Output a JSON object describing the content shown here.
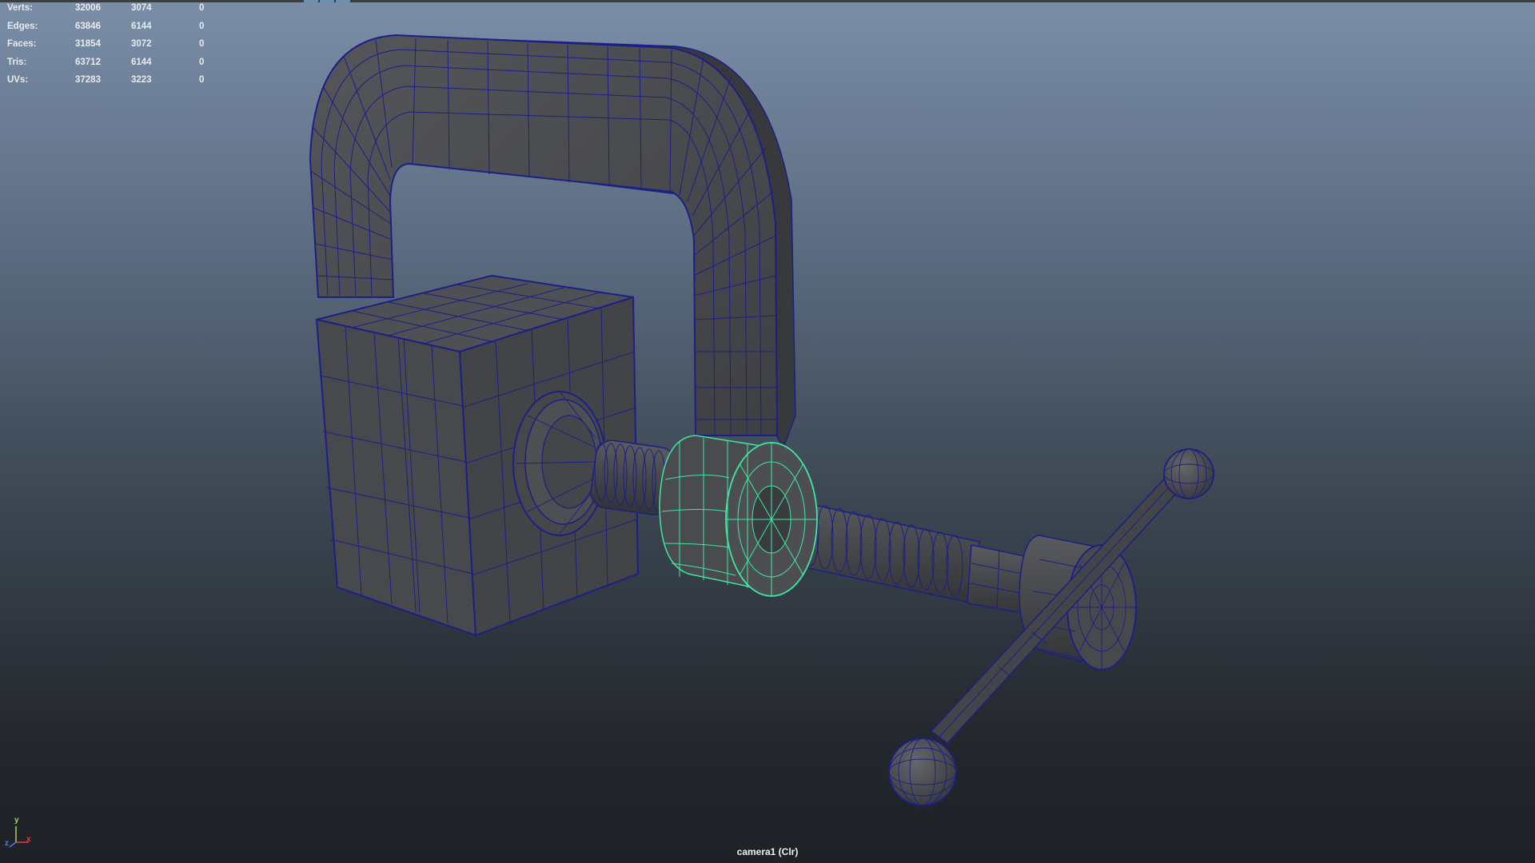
{
  "viewport": {
    "camera_label": "camera1 (Clr)"
  },
  "heads_up_display": {
    "rows": [
      {
        "label": "Verts:",
        "values": [
          "32006",
          "3074",
          "0"
        ]
      },
      {
        "label": "Edges:",
        "values": [
          "63846",
          "6144",
          "0"
        ]
      },
      {
        "label": "Faces:",
        "values": [
          "31854",
          "3072",
          "0"
        ]
      },
      {
        "label": "Tris:",
        "values": [
          "63712",
          "6144",
          "0"
        ]
      },
      {
        "label": "UVs:",
        "values": [
          "37283",
          "3223",
          "0"
        ]
      }
    ]
  },
  "axis_gizmo": {
    "y": "y",
    "x": "x",
    "z": "z"
  },
  "colors": {
    "wireframe": "#1c1f86",
    "selection_wireframe": "#3fe8a0",
    "mesh_shade": "#4a4a4d",
    "gradient_top": "#7b8ea8",
    "gradient_bottom": "#1e2125"
  }
}
